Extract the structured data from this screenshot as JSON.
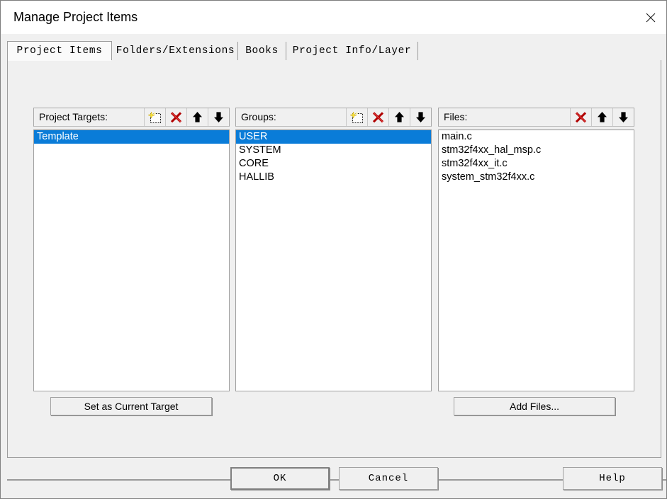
{
  "window": {
    "title": "Manage Project Items",
    "close_icon": "close-x-icon"
  },
  "tabs": [
    {
      "label": "Project Items",
      "active": true
    },
    {
      "label": "Folders/Extensions",
      "active": false
    },
    {
      "label": "Books",
      "active": false
    },
    {
      "label": "Project Info/Layer",
      "active": false
    }
  ],
  "columns": {
    "targets": {
      "title": "Project Targets:",
      "tools": [
        {
          "icon": "new-item-icon",
          "title": "New (Insert)"
        },
        {
          "icon": "delete-x-icon",
          "title": "Remove"
        },
        {
          "icon": "move-up-arrow-icon",
          "title": "Move Up"
        },
        {
          "icon": "move-down-arrow-icon",
          "title": "Move Down"
        }
      ],
      "items": [
        {
          "label": "Template",
          "selected": true
        }
      ],
      "button": "Set as Current Target"
    },
    "groups": {
      "title": "Groups:",
      "tools": [
        {
          "icon": "new-item-icon",
          "title": "New (Insert)"
        },
        {
          "icon": "delete-x-icon",
          "title": "Remove"
        },
        {
          "icon": "move-up-arrow-icon",
          "title": "Move Up"
        },
        {
          "icon": "move-down-arrow-icon",
          "title": "Move Down"
        }
      ],
      "items": [
        {
          "label": "USER",
          "selected": true
        },
        {
          "label": "SYSTEM",
          "selected": false
        },
        {
          "label": "CORE",
          "selected": false
        },
        {
          "label": "HALLIB",
          "selected": false
        }
      ]
    },
    "files": {
      "title": "Files:",
      "tools": [
        {
          "icon": "delete-x-icon",
          "title": "Remove"
        },
        {
          "icon": "move-up-arrow-icon",
          "title": "Move Up"
        },
        {
          "icon": "move-down-arrow-icon",
          "title": "Move Down"
        }
      ],
      "items": [
        {
          "label": "main.c",
          "selected": false
        },
        {
          "label": "stm32f4xx_hal_msp.c",
          "selected": false
        },
        {
          "label": "stm32f4xx_it.c",
          "selected": false
        },
        {
          "label": "system_stm32f4xx.c",
          "selected": false
        }
      ],
      "button": "Add Files..."
    }
  },
  "footer": {
    "ok": "OK",
    "cancel": "Cancel",
    "help": "Help"
  },
  "colors": {
    "selection_blue": "#0a7cd8",
    "dialog_face": "#f0f0f0",
    "delete_red": "#c00000",
    "new_icon_yellow": "#f5e03c"
  }
}
